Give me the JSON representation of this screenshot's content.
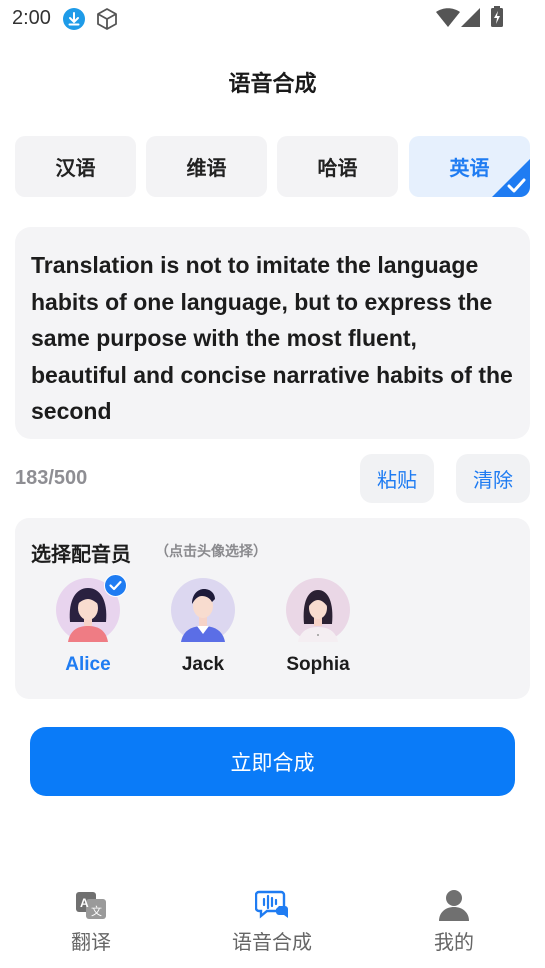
{
  "status_bar": {
    "time": "2:00"
  },
  "header": {
    "title": "语音合成"
  },
  "language_tabs": [
    {
      "label": "汉语",
      "selected": false
    },
    {
      "label": "维语",
      "selected": false
    },
    {
      "label": "哈语",
      "selected": false
    },
    {
      "label": "英语",
      "selected": true
    }
  ],
  "input": {
    "text": "Translation is not to imitate the language habits of one language, but to express the same purpose with the most fluent, beautiful and concise narrative habits of the second",
    "counter": "183/500"
  },
  "actions": {
    "paste": "粘贴",
    "clear": "清除"
  },
  "voice_picker": {
    "title": "选择配音员",
    "hint": "（点击头像选择）",
    "voices": [
      {
        "name": "Alice",
        "selected": true
      },
      {
        "name": "Jack",
        "selected": false
      },
      {
        "name": "Sophia",
        "selected": false
      }
    ]
  },
  "primary_button": {
    "label": "立即合成"
  },
  "bottom_nav": [
    {
      "label": "翻译",
      "icon": "translate-icon",
      "active": false
    },
    {
      "label": "语音合成",
      "icon": "voice-synthesis-icon",
      "active": true
    },
    {
      "label": "我的",
      "icon": "profile-icon",
      "active": false
    }
  ],
  "colors": {
    "accent": "#1f7cf2",
    "button": "#0a7bf8",
    "card": "#f4f4f6"
  }
}
